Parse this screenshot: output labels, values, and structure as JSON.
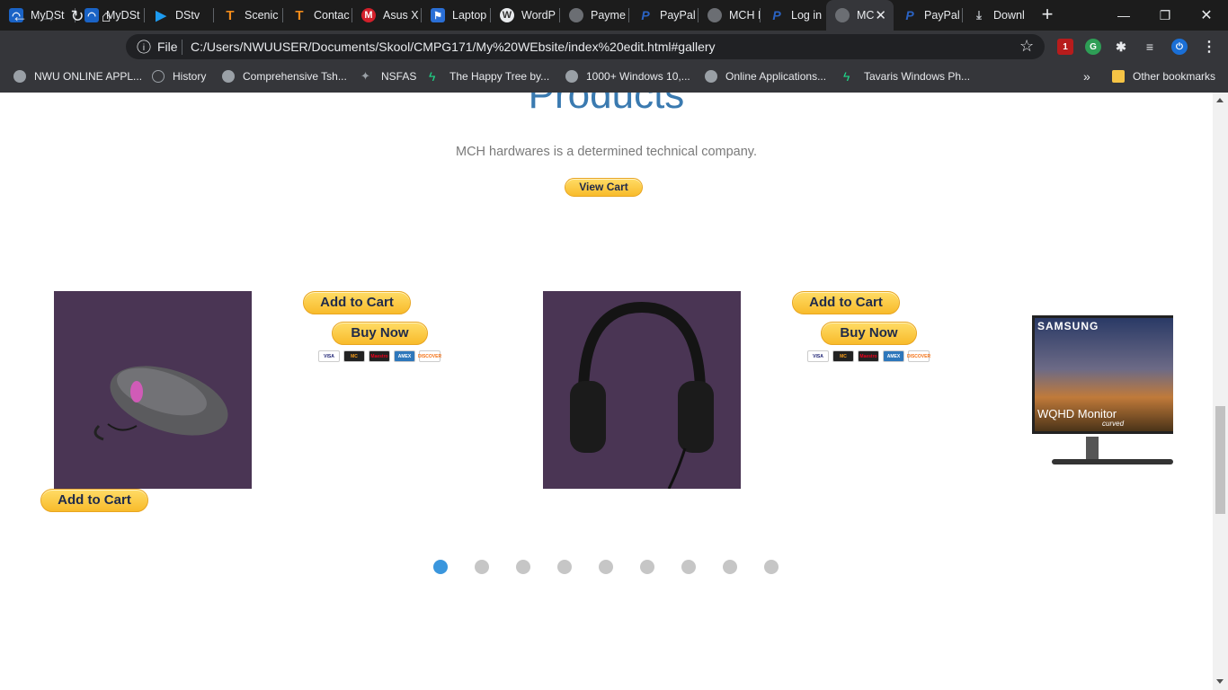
{
  "browser": {
    "tabs": [
      {
        "label": "MyDSt",
        "icon": "mydstv-icon"
      },
      {
        "label": "MyDSt",
        "icon": "mydstv-icon"
      },
      {
        "label": "DStv",
        "icon": "dstv-play-icon"
      },
      {
        "label": "Scenic",
        "icon": "t-icon"
      },
      {
        "label": "Contac",
        "icon": "t-icon"
      },
      {
        "label": "Asus X",
        "icon": "m-icon"
      },
      {
        "label": "Laptop",
        "icon": "flag-icon"
      },
      {
        "label": "WordP",
        "icon": "wordpress-icon"
      },
      {
        "label": "Payme",
        "icon": "globe-icon"
      },
      {
        "label": "PayPal",
        "icon": "paypal-icon"
      },
      {
        "label": "MCH H",
        "icon": "globe-icon"
      },
      {
        "label": "Log in",
        "icon": "paypal-icon"
      },
      {
        "label": "MC",
        "icon": "globe-icon"
      },
      {
        "label": "PayPal",
        "icon": "paypal-icon"
      },
      {
        "label": "Downl",
        "icon": "download-icon"
      }
    ],
    "new_tab_glyph": "+",
    "omnibox": {
      "scheme_label": "File",
      "url": "C:/Users/NWUUSER/Documents/Skool/CMPG171/My%20WEbsite/index%20edit.html#gallery"
    },
    "extension_badge": "1",
    "bookmarks": [
      "NWU ONLINE APPL...",
      "History",
      "Comprehensive Tsh...",
      "NSFAS",
      "The Happy Tree by...",
      "1000+ Windows 10,...",
      "Online Applications...",
      "Tavaris Windows Ph..."
    ],
    "bookmarks_overflow": "»",
    "other_bookmarks": "Other bookmarks"
  },
  "page": {
    "title": "Products",
    "tagline": "MCH hardwares is a determined technical company.",
    "view_cart_label": "View Cart",
    "add_to_cart_label": "Add to Cart",
    "buy_now_label": "Buy Now",
    "card_brands": [
      "VISA",
      "MC",
      "Maestro",
      "AMEX",
      "DISCOVER"
    ],
    "monitor_brand": "SAMSUNG",
    "monitor_caption": "WQHD Monitor",
    "monitor_sub": "curved",
    "carousel_dots": 9,
    "carousel_active_index": 0
  },
  "colors": {
    "title_blue": "#3a7ab0",
    "paypal_yellow": "#f8bb2b",
    "product_bg": "#4a3554",
    "dot_active": "#3a96dd"
  }
}
